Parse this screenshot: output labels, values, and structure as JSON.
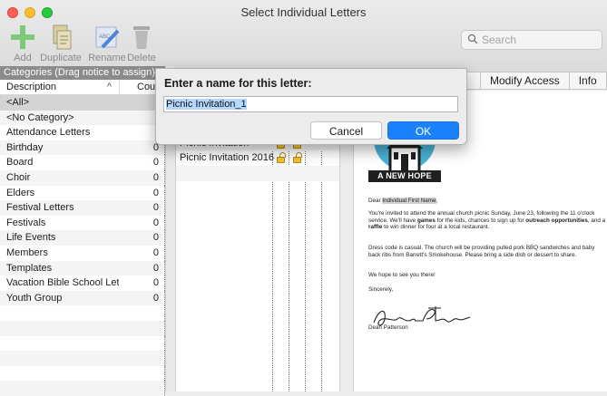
{
  "window": {
    "title": "Select Individual Letters"
  },
  "toolbar": {
    "add": "Add",
    "duplicate": "Duplicate",
    "rename": "Rename",
    "delete": "Delete",
    "search_placeholder": "Search"
  },
  "categories": {
    "header": "Categories (Drag notice to assign)",
    "col_description": "Description",
    "col_count": "Cou",
    "rows": [
      {
        "label": "<All>",
        "count": ""
      },
      {
        "label": "<No Category>",
        "count": ""
      },
      {
        "label": "Attendance Letters",
        "count": ""
      },
      {
        "label": "Birthday",
        "count": "0"
      },
      {
        "label": "Board",
        "count": "0"
      },
      {
        "label": "Choir",
        "count": "0"
      },
      {
        "label": "Elders",
        "count": "0"
      },
      {
        "label": "Festival Letters",
        "count": "0"
      },
      {
        "label": "Festivals",
        "count": "0"
      },
      {
        "label": "Life Events",
        "count": "0"
      },
      {
        "label": "Members",
        "count": "0"
      },
      {
        "label": "Templates",
        "count": "0"
      },
      {
        "label": "Vacation Bible School Let",
        "count": "0"
      },
      {
        "label": "Youth Group",
        "count": "0"
      },
      {
        "label": "",
        "count": ""
      },
      {
        "label": "",
        "count": ""
      },
      {
        "label": "",
        "count": ""
      },
      {
        "label": "",
        "count": ""
      },
      {
        "label": "",
        "count": ""
      },
      {
        "label": "",
        "count": ""
      }
    ]
  },
  "letters": {
    "rows": [
      {
        "name": "",
        "locks": false
      },
      {
        "name": "",
        "locks": false
      },
      {
        "name": "",
        "locks": false
      },
      {
        "name": "Picnic Invitation",
        "locks": true
      },
      {
        "name": "Picnic Invitation 2016",
        "locks": true
      },
      {
        "name": "",
        "locks": false
      }
    ]
  },
  "tabs": {
    "tab1": "s",
    "tab2": "Modify Access",
    "tab3": "Info"
  },
  "preview": {
    "banner": "A NEW HOPE",
    "greeting_prefix": "Dear ",
    "greeting_field": "Individual First Name",
    "greeting_suffix": ",",
    "para1_a": "You're invited to attend the annual church picnic Sunday, June 23, following the 11 o'clock service. We'll have ",
    "para1_games": "games",
    "para1_b": " for the kids, chances to sign up for ",
    "para1_outreach": "outreach opportunities",
    "para1_c": ", and a ",
    "para1_raffle": "raffle",
    "para1_d": " to win dinner for four at a local restaurant.",
    "para2": "Dress code is casual. The church will be providing pulled pork BBQ sandwiches and baby back ribs from Barrett's Smokehouse. Please bring a side dish or dessert to share.",
    "para3": "We hope to see you there!",
    "closing": "Sincerely,",
    "signer": "Dean Patterson"
  },
  "dialog": {
    "title": "Enter a name for this letter:",
    "input_value": "Picnic Invitation_1",
    "cancel": "Cancel",
    "ok": "OK"
  },
  "colors": {
    "accent": "#1a82fb",
    "lock": "#f3c230",
    "logo_circle": "#4ab3d6"
  }
}
